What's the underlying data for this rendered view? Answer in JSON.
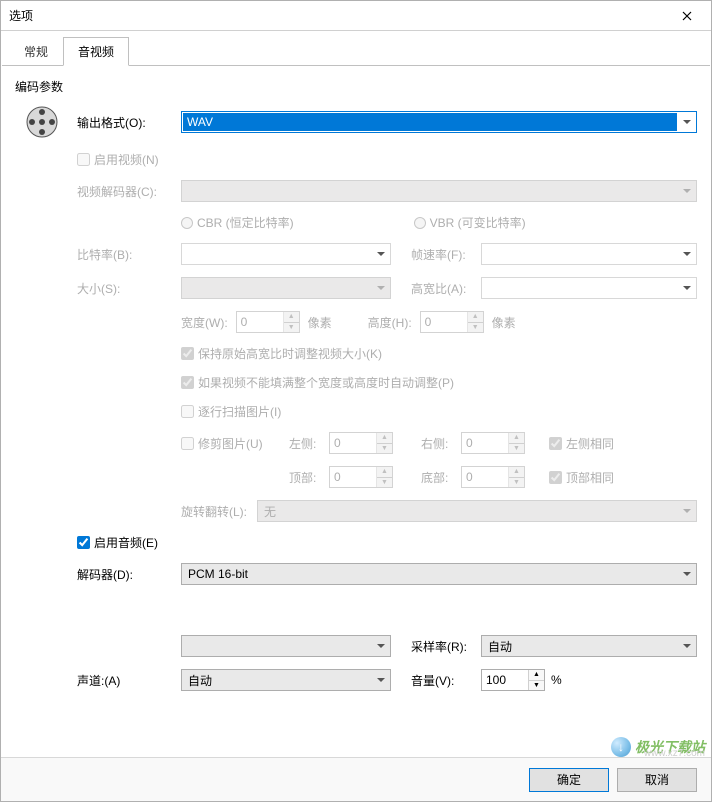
{
  "window": {
    "title": "选项"
  },
  "tabs": {
    "general": "常规",
    "av": "音视频"
  },
  "section": "编码参数",
  "labels": {
    "outputFormat": "输出格式(O):",
    "enableVideo": "启用视频(N)",
    "videoDecoder": "视频解码器(C):",
    "cbr": "CBR (恒定比特率)",
    "vbr": "VBR (可变比特率)",
    "bitrate": "比特率(B):",
    "framerate": "帧速率(F):",
    "size": "大小(S):",
    "aspect": "高宽比(A):",
    "widthW": "宽度(W):",
    "heightH": "高度(H):",
    "pixels": "像素",
    "keepRatio": "保持原始高宽比时调整视频大小(K)",
    "autoAdjust": "如果视频不能填满整个宽度或高度时自动调整(P)",
    "interlaced": "逐行扫描图片(I)",
    "crop": "修剪图片(U)",
    "left": "左侧:",
    "right": "右侧:",
    "top": "顶部:",
    "bottom": "底部:",
    "sameLeft": "左侧相同",
    "sameTop": "顶部相同",
    "rotate": "旋转翻转(L):",
    "rotateNone": "无",
    "enableAudio": "启用音频(E)",
    "decoder": "解码器(D):",
    "samplerate": "采样率(R):",
    "channels": "声道:(A)",
    "volume": "音量(V):",
    "percent": "%"
  },
  "values": {
    "outputFormat": "WAV",
    "width": "0",
    "height": "0",
    "cropLeft": "0",
    "cropRight": "0",
    "cropTop": "0",
    "cropBottom": "0",
    "decoder": "PCM 16-bit",
    "samplerate": "自动",
    "channels": "自动",
    "volume": "100"
  },
  "footer": {
    "ok": "确定",
    "cancel": "取消"
  },
  "watermark": {
    "text": "极光下载站",
    "url": "www.xz7.com"
  }
}
